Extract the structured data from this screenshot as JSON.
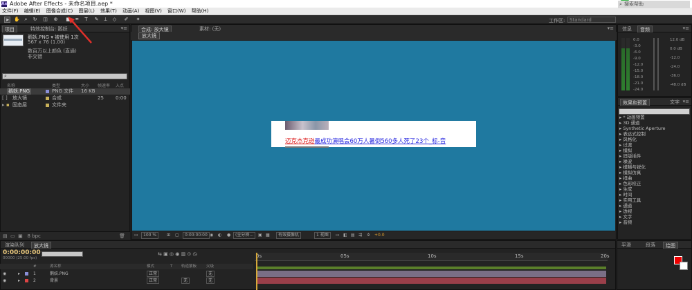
{
  "window": {
    "title": "Adobe After Effects - 未命名项目.aep *",
    "app_icon": "Ae",
    "minimize": "—",
    "maximize": "❐",
    "close": "✕"
  },
  "menu": [
    "文件(F)",
    "编辑(E)",
    "图像合成(C)",
    "图层(L)",
    "效果(T)",
    "动画(A)",
    "视图(V)",
    "窗口(W)",
    "帮助(H)"
  ],
  "toolbar": {
    "workspace_label": "工作区:",
    "workspace_value": "Standard",
    "help_search_placeholder": "搜索帮助"
  },
  "project_panel": {
    "tabs": [
      "项目",
      "特效控制台: 鹅妖"
    ],
    "selected_name": "鹅妖.PNG ▾  被使用 1次",
    "selected_dims": "567 x 76 (1.00)",
    "selected_info1": "数百万以上颜色 (直通)",
    "selected_info2": "非交错",
    "columns": [
      "名称",
      "类型",
      "大小",
      "帧速率",
      "入点"
    ],
    "items": [
      {
        "name": "鹅妖.PNG",
        "type": "PNG 文件",
        "size": "16 KB",
        "fps": "",
        "in": "",
        "color": "#8a8fd8"
      },
      {
        "name": "放大镜",
        "type": "合成",
        "size": "",
        "fps": "25",
        "in": "0:00",
        "color": "#c9b25a"
      },
      {
        "name": "固态层",
        "type": "文件夹",
        "size": "",
        "fps": "",
        "in": "",
        "color": "#c9b25a"
      }
    ],
    "footer_bpc": "8 bpc"
  },
  "comp_panel": {
    "tab_label": "合成: 放大镜",
    "footage_label": "素材: (无)",
    "inner_tab": "放大镜",
    "headline_red": "迈克杰克逊",
    "headline_blue": "最成功演唱会60万人暑倒560多人死了23个_标-音",
    "zoom": "100 %",
    "timecode": "0:00:00:00",
    "resolution": "(全分辨...",
    "camera": "有效摄像机",
    "views": "1 视图",
    "exposure": "+0.0"
  },
  "info_panel": {
    "tabs": [
      "信息",
      "音频"
    ],
    "left_scale": [
      "0.0",
      "-3.0",
      "-6.0",
      "-9.0",
      "-12.0",
      "-15.0",
      "-18.0",
      "-21.0",
      "-24.0"
    ],
    "right_scale": [
      "12.0 dB",
      "0.0 dB",
      "-12.0",
      "-24.0",
      "-36.0",
      "-48.0 dB"
    ]
  },
  "effects_panel": {
    "tabs": [
      "效果和预置",
      "文字"
    ],
    "items": [
      "▸ * 动画预置",
      "▸ 3D 通道",
      "▸ Synthetic Aperture",
      "▸ 表达式控制",
      "▸ 风格化",
      "▸ 过渡",
      "▸ 模拟",
      "▸ 旧版插件",
      "▸ 噪波",
      "▸ 模糊与锐化",
      "▸ 模拟仿真",
      "▸ 扭曲",
      "▸ 色彩校正",
      "▸ 生成",
      "▸ 时间",
      "▸ 实用工具",
      "▸ 通道",
      "▸ 透视",
      "▸ 文字",
      "▸ 音频"
    ]
  },
  "timeline": {
    "tabs": [
      "渲染队列",
      "放大镜"
    ],
    "timecode": "0:00:00:00",
    "timecode_sub": "00000 (25.00 fps)",
    "columns": [
      "#",
      "源名称",
      "模式",
      "T",
      "轨道蒙板",
      "父级"
    ],
    "layers": [
      {
        "num": "1",
        "name": "鹅妖.PNG",
        "mode": "正常",
        "parent": "无",
        "color": "#8a8fd8"
      },
      {
        "num": "2",
        "name": "背景",
        "mode": "正常",
        "matte": "无",
        "parent": "无",
        "color": "#d44"
      }
    ],
    "ruler_marks": [
      "0s",
      "05s",
      "10s",
      "15s",
      "20s"
    ]
  },
  "right_bottom": {
    "tabs": [
      "平滑",
      "段落",
      "绘图"
    ],
    "fg_color": "#f00000",
    "bg_color": "#ffffff"
  }
}
